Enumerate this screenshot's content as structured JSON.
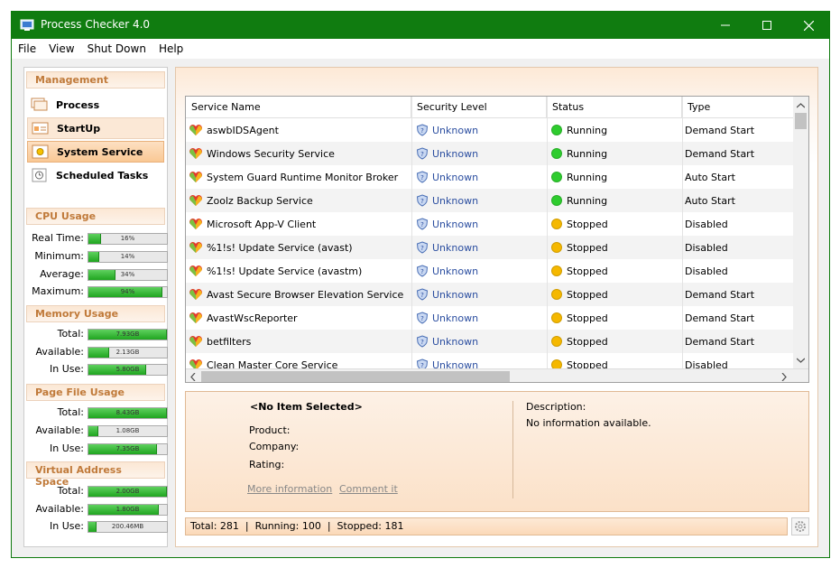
{
  "window": {
    "title": "Process Checker 4.0"
  },
  "menu": [
    "File",
    "View",
    "Shut Down",
    "Help"
  ],
  "sidebar": {
    "management_header": "Management",
    "nav": [
      {
        "label": "Process",
        "state": "normal"
      },
      {
        "label": "StartUp",
        "state": "highlight"
      },
      {
        "label": "System Service",
        "state": "active"
      },
      {
        "label": "Scheduled Tasks",
        "state": "normal"
      }
    ],
    "sections": [
      {
        "header": "CPU Usage",
        "rows": [
          {
            "label": "Real Time:",
            "value": "16%",
            "fraction": 0.16
          },
          {
            "label": "Minimum:",
            "value": "14%",
            "fraction": 0.14
          },
          {
            "label": "Average:",
            "value": "34%",
            "fraction": 0.34
          },
          {
            "label": "Maximum:",
            "value": "94%",
            "fraction": 0.94
          }
        ]
      },
      {
        "header": "Memory Usage",
        "rows": [
          {
            "label": "Total:",
            "value": "7.93GB",
            "fraction": 1.0
          },
          {
            "label": "Available:",
            "value": "2.13GB",
            "fraction": 0.27
          },
          {
            "label": "In Use:",
            "value": "5.80GB",
            "fraction": 0.73
          }
        ]
      },
      {
        "header": "Page File Usage",
        "rows": [
          {
            "label": "Total:",
            "value": "8.43GB",
            "fraction": 1.0
          },
          {
            "label": "Available:",
            "value": "1.08GB",
            "fraction": 0.13
          },
          {
            "label": "In Use:",
            "value": "7.35GB",
            "fraction": 0.87
          }
        ]
      },
      {
        "header": "Virtual Address Space",
        "rows": [
          {
            "label": "Total:",
            "value": "2.00GB",
            "fraction": 1.0
          },
          {
            "label": "Available:",
            "value": "1.80GB",
            "fraction": 0.9
          },
          {
            "label": "In Use:",
            "value": "200.46MB",
            "fraction": 0.1
          }
        ]
      }
    ]
  },
  "table": {
    "columns": [
      "Service Name",
      "Security Level",
      "Status",
      "Type"
    ],
    "rows": [
      {
        "name": "aswbIDSAgent",
        "security": "Unknown",
        "status": "Running",
        "type": "Demand Start"
      },
      {
        "name": "Windows Security Service",
        "security": "Unknown",
        "status": "Running",
        "type": "Demand Start"
      },
      {
        "name": "System Guard Runtime Monitor Broker",
        "security": "Unknown",
        "status": "Running",
        "type": "Auto Start"
      },
      {
        "name": "Zoolz Backup Service",
        "security": "Unknown",
        "status": "Running",
        "type": "Auto Start"
      },
      {
        "name": "Microsoft App-V Client",
        "security": "Unknown",
        "status": "Stopped",
        "type": "Disabled"
      },
      {
        "name": "%1!s! Update Service (avast)",
        "security": "Unknown",
        "status": "Stopped",
        "type": "Disabled"
      },
      {
        "name": "%1!s! Update Service (avastm)",
        "security": "Unknown",
        "status": "Stopped",
        "type": "Disabled"
      },
      {
        "name": "Avast Secure Browser Elevation Service",
        "security": "Unknown",
        "status": "Stopped",
        "type": "Demand Start"
      },
      {
        "name": "AvastWscReporter",
        "security": "Unknown",
        "status": "Stopped",
        "type": "Demand Start"
      },
      {
        "name": "betfilters",
        "security": "Unknown",
        "status": "Stopped",
        "type": "Demand Start"
      },
      {
        "name": "Clean Master Core Service",
        "security": "Unknown",
        "status": "Stopped",
        "type": "Disabled"
      }
    ]
  },
  "detail": {
    "selected": "<No Item Selected>",
    "product_label": "Product:",
    "company_label": "Company:",
    "rating_label": "Rating:",
    "more_info": "More information",
    "comment": "Comment it",
    "description_label": "Description:",
    "description_value": "No information available."
  },
  "status_bar": "Total: 281  |  Running: 100  |  Stopped: 181",
  "colors": {
    "titlebar": "#107c10",
    "running": "#2ecc2e",
    "stopped": "#f5b800",
    "link": "#2b4ea0"
  }
}
